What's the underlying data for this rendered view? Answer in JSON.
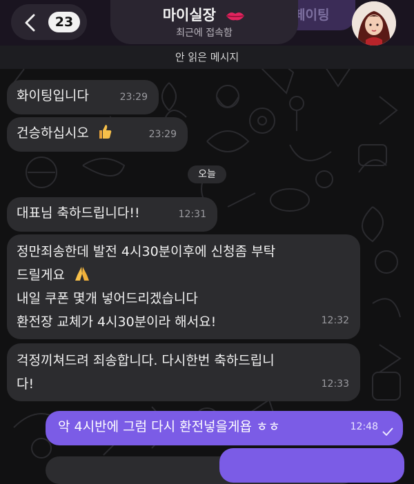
{
  "header": {
    "unread_count": "23",
    "title": "마이실장",
    "subtitle": "최근에 접속함",
    "ghost_label": "페이팅"
  },
  "unread_divider": "안 읽은 메시지",
  "date_separator": "오늘",
  "messages": [
    {
      "side": "in",
      "lines": [
        "화이팅입니다"
      ],
      "time": "23:29"
    },
    {
      "side": "in",
      "lines": [
        "건승하십시오"
      ],
      "time": "23:29",
      "emoji": "thumbs-up"
    },
    {
      "side": "in",
      "lines": [
        "대표님 축하드립니다!!"
      ],
      "time": "12:31"
    },
    {
      "side": "in",
      "lines": [
        "정만죄송한데 발전 4시30분이후에 신청좀 부탁",
        "드릴게요",
        "내일 쿠폰 몇개 넣어드리겠습니다",
        "환전장 교체가 4시30분이라 해서요!"
      ],
      "time": "12:32",
      "emoji": "folded-hands"
    },
    {
      "side": "in",
      "lines": [
        "걱정끼쳐드려 죄송합니다. 다시한번 축하드립니",
        "다!"
      ],
      "time": "12:33"
    },
    {
      "side": "out",
      "lines": [
        "악 4시반에 그럼 다시 환전넣을게욥 ㅎㅎ"
      ],
      "time": "12:48",
      "status": "read-check"
    }
  ]
}
